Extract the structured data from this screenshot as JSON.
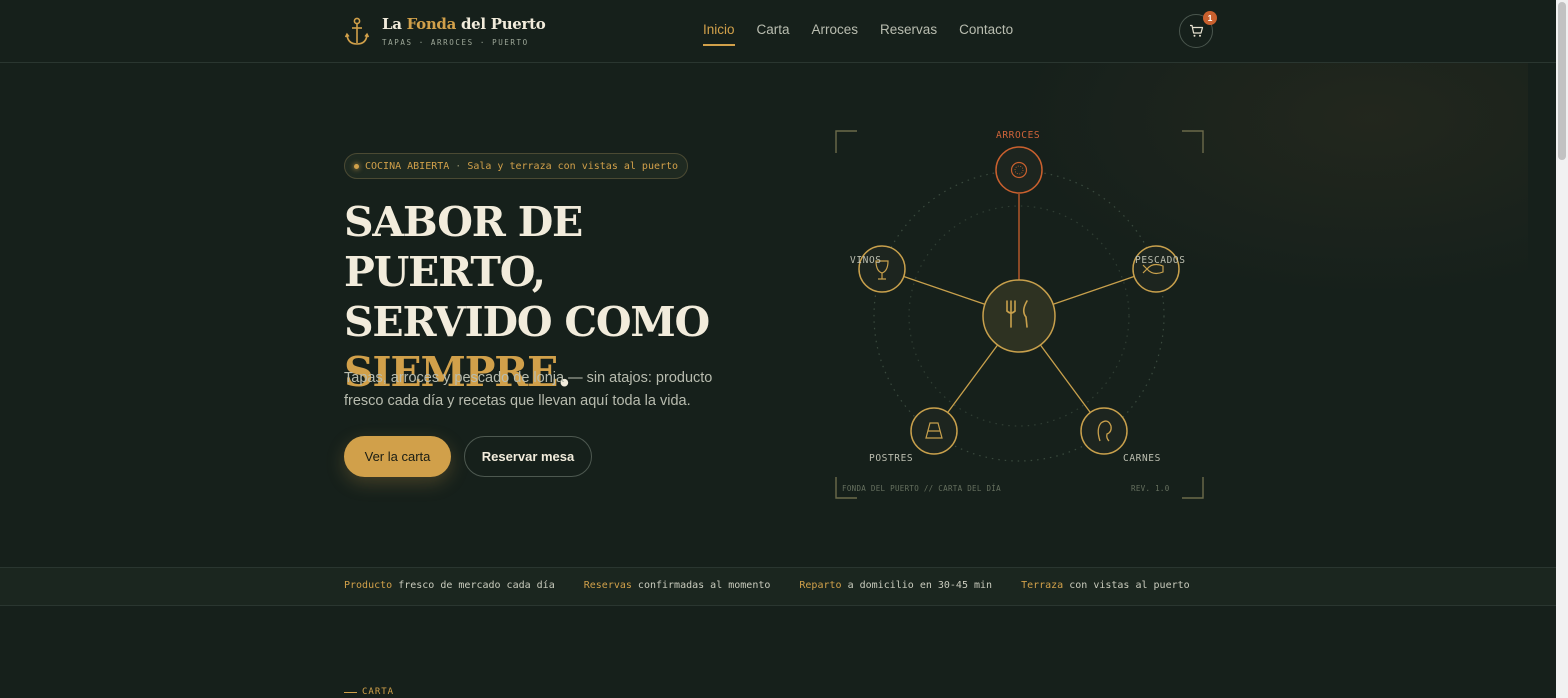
{
  "brand": {
    "name_part1": "La ",
    "name_accent": "Fonda",
    "name_part2": " del Puerto",
    "tagline": "TAPAS · ARROCES · PUERTO",
    "icon": "anchor-icon"
  },
  "nav": {
    "items": [
      {
        "label": "Inicio",
        "active": true
      },
      {
        "label": "Carta",
        "active": false
      },
      {
        "label": "Arroces",
        "active": false
      },
      {
        "label": "Reservas",
        "active": false
      },
      {
        "label": "Contacto",
        "active": false
      }
    ]
  },
  "cart": {
    "icon": "cart-icon",
    "count": "1"
  },
  "hero": {
    "pill_strong": "COCINA ABIERTA",
    "pill_sep": "·",
    "pill_text": "Sala y terraza con vistas al puerto",
    "title_line1": "SABOR DE PUERTO,",
    "title_line2": "SERVIDO COMO",
    "title_accent": "SIEMPRE",
    "title_end": ".",
    "lead": "Tapas, arroces y pescado de lonja — sin atajos: producto fresco cada día y recetas que llevan aquí toda la vida.",
    "primary_button": "Ver la carta",
    "secondary_button": "Reservar mesa"
  },
  "diagram": {
    "center_icon": "cutlery-icon",
    "nodes": [
      {
        "label": "ARROCES",
        "icon": "paella-icon",
        "highlight": true
      },
      {
        "label": "PESCADOS",
        "icon": "fish-icon",
        "highlight": false
      },
      {
        "label": "CARNES",
        "icon": "steak-icon",
        "highlight": false
      },
      {
        "label": "POSTRES",
        "icon": "cake-icon",
        "highlight": false
      },
      {
        "label": "VINOS",
        "icon": "wine-glass-icon",
        "highlight": false
      }
    ],
    "footer_left": "FONDA DEL PUERTO // CARTA DEL DÍA",
    "footer_right": "REV. 1.0"
  },
  "features": [
    {
      "key": "Producto",
      "text": " fresco de mercado cada día"
    },
    {
      "key": "Reservas",
      "text": " confirmadas al momento"
    },
    {
      "key": "Reparto",
      "text": " a domicilio en 30-45 min"
    },
    {
      "key": "Terraza",
      "text": " con vistas al puerto"
    }
  ],
  "next_section": {
    "label": "CARTA"
  },
  "colors": {
    "background": "#16201b",
    "accent_gold": "#d1a04a",
    "accent_rust": "#c9602e",
    "text_light": "#f2ecdc"
  }
}
